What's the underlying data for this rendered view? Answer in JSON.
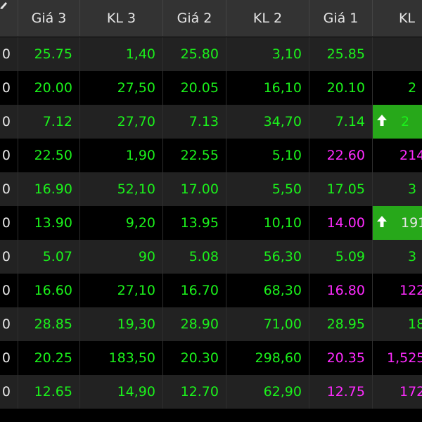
{
  "theme": {
    "green": "#1bf21b",
    "magenta": "#ff2bff",
    "highlight": "#27a81a"
  },
  "headers": [
    "Giá 3",
    "KL 3",
    "Giá 2",
    "KL 2",
    "Giá 1",
    "KL"
  ],
  "rows": [
    {
      "c0": "0",
      "gia3": "25.75",
      "kl3": "1,40",
      "gia2": "25.80",
      "kl2": "3,10",
      "gia1": "25.85",
      "gia1_color": "green",
      "kl1": "",
      "kl1_color": "green",
      "highlight": false
    },
    {
      "c0": "0",
      "gia3": "20.00",
      "kl3": "27,50",
      "gia2": "20.05",
      "kl2": "16,10",
      "gia1": "20.10",
      "gia1_color": "green",
      "kl1": "2",
      "kl1_color": "green",
      "highlight": false
    },
    {
      "c0": "0",
      "gia3": "7.12",
      "kl3": "27,70",
      "gia2": "7.13",
      "kl2": "34,70",
      "gia1": "7.14",
      "gia1_color": "green",
      "kl1": "2",
      "kl1_color": "green",
      "highlight": true
    },
    {
      "c0": "0",
      "gia3": "22.50",
      "kl3": "1,90",
      "gia2": "22.55",
      "kl2": "5,10",
      "gia1": "22.60",
      "gia1_color": "magenta",
      "kl1": "214",
      "kl1_color": "magenta",
      "highlight": false
    },
    {
      "c0": "0",
      "gia3": "16.90",
      "kl3": "52,10",
      "gia2": "17.00",
      "kl2": "5,50",
      "gia1": "17.05",
      "gia1_color": "green",
      "kl1": "3",
      "kl1_color": "green",
      "highlight": false
    },
    {
      "c0": "0",
      "gia3": "13.90",
      "kl3": "9,20",
      "gia2": "13.95",
      "kl2": "10,10",
      "gia1": "14.00",
      "gia1_color": "magenta",
      "kl1": "191",
      "kl1_color": "white",
      "highlight": true
    },
    {
      "c0": "0",
      "gia3": "5.07",
      "kl3": "90",
      "gia2": "5.08",
      "kl2": "56,30",
      "gia1": "5.09",
      "gia1_color": "green",
      "kl1": "3",
      "kl1_color": "green",
      "highlight": false
    },
    {
      "c0": "0",
      "gia3": "16.60",
      "kl3": "27,10",
      "gia2": "16.70",
      "kl2": "68,30",
      "gia1": "16.80",
      "gia1_color": "magenta",
      "kl1": "122",
      "kl1_color": "magenta",
      "highlight": false
    },
    {
      "c0": "0",
      "gia3": "28.85",
      "kl3": "19,30",
      "gia2": "28.90",
      "kl2": "71,00",
      "gia1": "28.95",
      "gia1_color": "green",
      "kl1": "18",
      "kl1_color": "green",
      "highlight": false
    },
    {
      "c0": "0",
      "gia3": "20.25",
      "kl3": "183,50",
      "gia2": "20.30",
      "kl2": "298,60",
      "gia1": "20.35",
      "gia1_color": "magenta",
      "kl1": "1,525",
      "kl1_color": "magenta",
      "highlight": false
    },
    {
      "c0": "0",
      "gia3": "12.65",
      "kl3": "14,90",
      "gia2": "12.70",
      "kl2": "62,90",
      "gia1": "12.75",
      "gia1_color": "magenta",
      "kl1": "172",
      "kl1_color": "magenta",
      "highlight": false
    }
  ]
}
